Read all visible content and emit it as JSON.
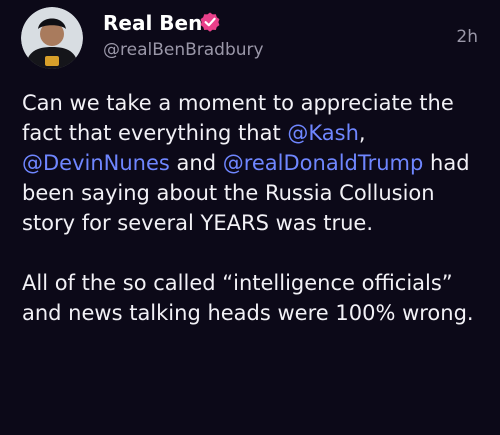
{
  "author": {
    "display_name": "Real Ben",
    "handle": "@realBenBradbury",
    "verified": true
  },
  "post": {
    "time_ago": "2h",
    "p1": {
      "t1": "Can we take a moment to appreciate the fact that everything that ",
      "m1": "@Kash",
      "t2": ", ",
      "m2": "@DevinNunes",
      "t3": " and ",
      "m3": "@realDonaldTrump",
      "t4": " had been saying about the Russia Collusion story for several YEARS was true."
    },
    "p2": "All of the so called “intelligence officials” and news talking heads were 100% wrong."
  },
  "colors": {
    "background": "#0c0918",
    "mention": "#6f86ff",
    "verified_badge": "#e9408a"
  }
}
